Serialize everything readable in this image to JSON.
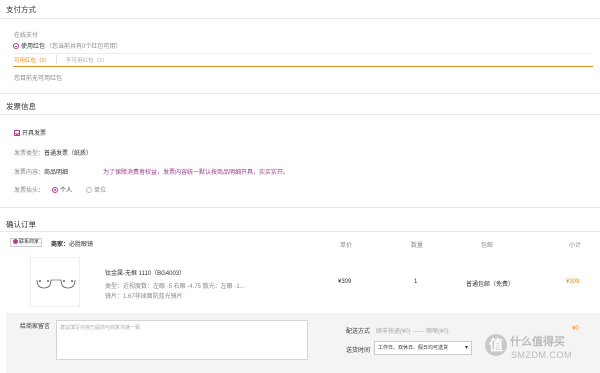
{
  "payment": {
    "title": "支付方式",
    "online_label": "在线支付",
    "use_hongbao": "使用红包",
    "hongbao_note": "（您当前共有0个红包可用）",
    "tab_available": "可用红包（0）",
    "tab_unavailable": "不可用红包（2）",
    "empty_text": "您目前无可用红包"
  },
  "invoice": {
    "title": "发票信息",
    "open_label": "开具发票",
    "type_label": "发票类型：",
    "type_value": "普通发票（纸质）",
    "content_label": "发票内容：",
    "content_value": "商品明细",
    "content_note": "为了保障消费者权益，发票内容统一默认按商品明细开具，实买实开。",
    "header_label": "发票抬头：",
    "option_personal": "个人",
    "option_company": "单位"
  },
  "order": {
    "title": "确认订单",
    "chat_btn": "联系商家",
    "shop_label": "商家：",
    "shop_name": "必胜眼镜",
    "col_price": "单价",
    "col_qty": "数量",
    "col_shipping": "包邮",
    "col_subtotal": "小计",
    "product_title": "钛金属-无框 1110（BG4003）",
    "product_spec": "类型：近视度数：左眼 -5 右眼 -4.75 散光：左眼 -1...",
    "product_lens": "镜片：1.67非球面防蓝光镜片",
    "price": "¥309",
    "qty": "1",
    "shipping_type": "普通包邮（免费）",
    "subtotal": "¥309"
  },
  "message": {
    "label": "给商家留言",
    "placeholder": "建议填写内容已提前与商家沟通一致"
  },
  "delivery": {
    "method_label": "配送方式",
    "method_options": "顺丰快递(¥0)  ------ 噢噢(¥0)",
    "method_value": "¥0",
    "time_label": "送货时间",
    "time_value": "工作日、双休日、假日均可送货"
  },
  "watermark": {
    "logo_char": "值",
    "brand": "什么值得买",
    "domain": "SMZDM.COM"
  }
}
